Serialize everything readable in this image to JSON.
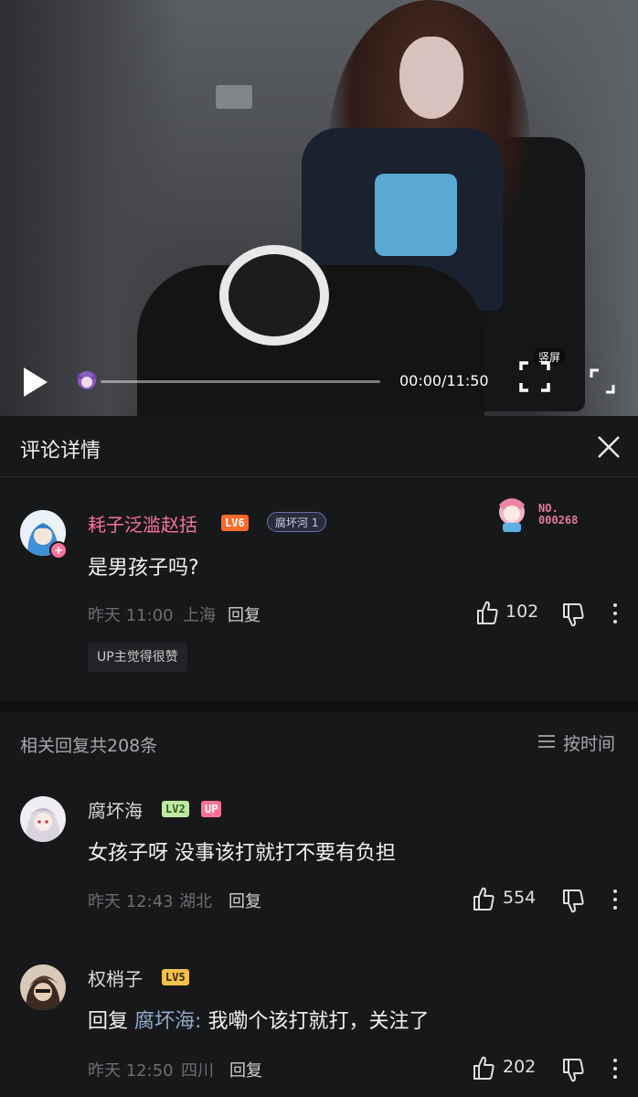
{
  "video": {
    "time_display": "00:00/11:50",
    "progress": 0.0,
    "vertical_label": "竖屏"
  },
  "header": {
    "title": "评论详情"
  },
  "main_comment": {
    "username": "耗子泛滥赵括",
    "username_color": "#fb7299",
    "level": "LV6",
    "fan_badge": "腐坏河 1",
    "deco_number_prefix": "NO.",
    "deco_number": "000268",
    "text": "是男孩子吗?",
    "time": "昨天 11:00",
    "location": "上海",
    "reply_label": "回复",
    "likes": "102",
    "up_liked": "UP主觉得很赞"
  },
  "replies_header": {
    "count_text": "相关回复共208条",
    "sort_label": "按时间"
  },
  "replies": [
    {
      "username": "腐坏海",
      "level": "LV2",
      "up_badge": "UP",
      "text": "女孩子呀 没事该打就打不要有负担",
      "time": "昨天 12:43",
      "location": "湖北",
      "reply_label": "回复",
      "likes": "554"
    },
    {
      "username": "权梢子",
      "level": "LV5",
      "reply_prefix": "回复",
      "reply_to": "腐坏海:",
      "text": "我嘞个该打就打，关注了",
      "time": "昨天 12:50",
      "location": "四川",
      "reply_label": "回复",
      "likes": "202"
    }
  ],
  "colors": {
    "accent": "#fb7299",
    "background": "#17181a",
    "muted": "#6b6d70"
  }
}
